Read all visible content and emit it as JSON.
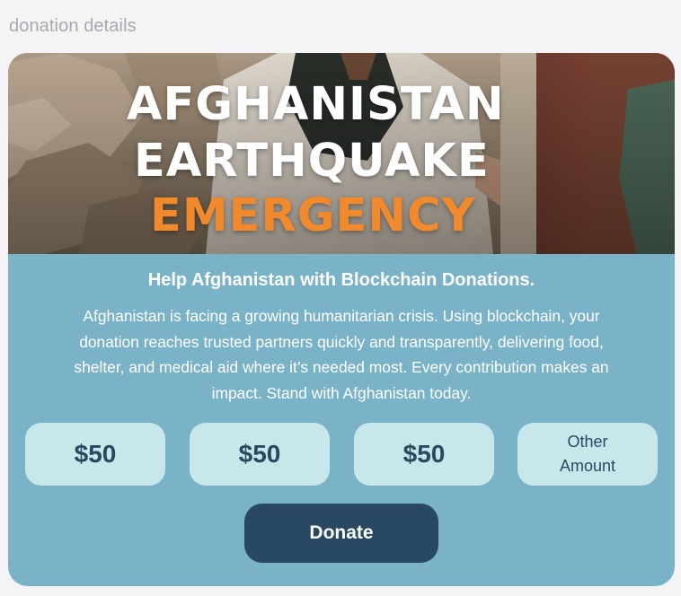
{
  "page": {
    "section_label": "donation details"
  },
  "hero": {
    "line1": "AFGHANISTAN",
    "line2": "EARTHQUAKE",
    "line3": "EMERGENCY",
    "accent_color": "#f08a2c"
  },
  "content": {
    "heading": "Help Afghanistan with Blockchain Donations.",
    "body": "Afghanistan is facing a growing humanitarian crisis. Using blockchain, your donation reaches trusted partners quickly and transparently, delivering food, shelter, and medical aid where it’s needed most. Every contribution makes an impact. Stand with Afghanistan today."
  },
  "amounts": [
    {
      "label": "$50"
    },
    {
      "label": "$50"
    },
    {
      "label": "$50"
    }
  ],
  "other_amount": {
    "line1": "Other",
    "line2": "Amount"
  },
  "donate": {
    "label": "Donate"
  },
  "colors": {
    "card_bg": "#7ab3c8",
    "amount_btn_bg": "#c8e7ea",
    "donate_btn_bg": "#284961",
    "text_dark": "#284961"
  }
}
